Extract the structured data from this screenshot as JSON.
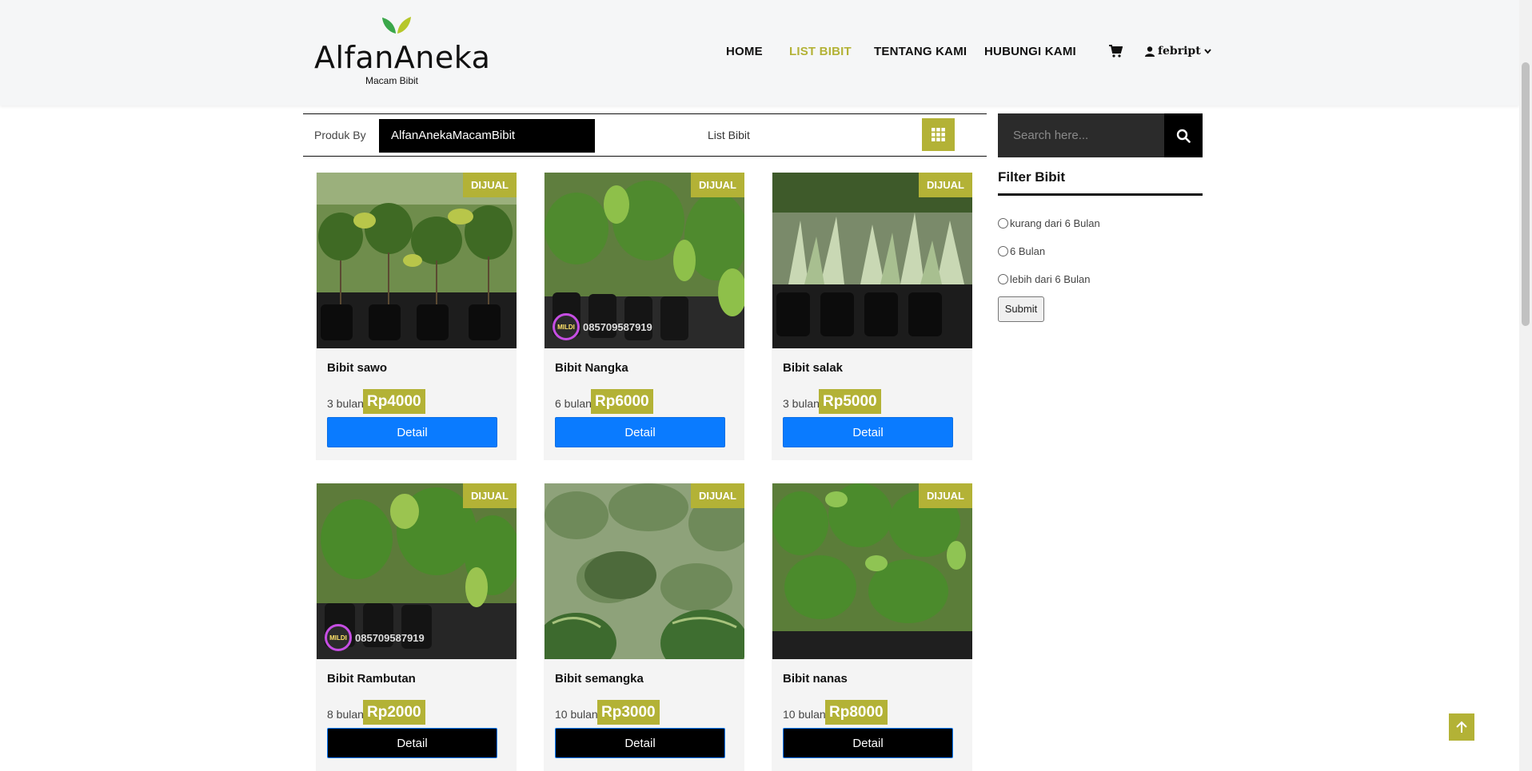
{
  "brand": {
    "name": "AlfanAneka",
    "tagline": "Macam Bibit",
    "accent": "#b3b236"
  },
  "nav": {
    "items": [
      "HOME",
      "LIST BIBIT",
      "TENTANG KAMI",
      "HUBUNGI KAMI"
    ],
    "active": "LIST BIBIT",
    "user": "febript"
  },
  "toolbar": {
    "produk_label": "Produk By",
    "produk_value": "AlfanAnekaMacamBibit",
    "list_label": "List Bibit"
  },
  "products": [
    {
      "badge": "DIJUAL",
      "name": "Bibit sawo",
      "age": "3 bulan",
      "price": "Rp4000",
      "button": "Detail"
    },
    {
      "badge": "DIJUAL",
      "name": "Bibit Nangka",
      "age": "6 bulan",
      "price": "Rp6000",
      "button": "Detail",
      "watermark": "085709587919"
    },
    {
      "badge": "DIJUAL",
      "name": "Bibit salak",
      "age": "3 bulan",
      "price": "Rp5000",
      "button": "Detail"
    },
    {
      "badge": "DIJUAL",
      "name": "Bibit Rambutan",
      "age": "8 bulan",
      "price": "Rp2000",
      "button": "Detail",
      "watermark": "085709587919"
    },
    {
      "badge": "DIJUAL",
      "name": "Bibit semangka",
      "age": "10 bulan",
      "price": "Rp3000",
      "button": "Detail"
    },
    {
      "badge": "DIJUAL",
      "name": "Bibit nanas",
      "age": "10 bulan",
      "price": "Rp8000",
      "button": "Detail"
    }
  ],
  "sidebar": {
    "search_placeholder": "Search here...",
    "filter_title": "Filter Bibit",
    "filter_options": [
      "kurang dari 6 Bulan",
      "6 Bulan",
      "lebih dari 6 Bulan"
    ],
    "submit": "Submit"
  }
}
